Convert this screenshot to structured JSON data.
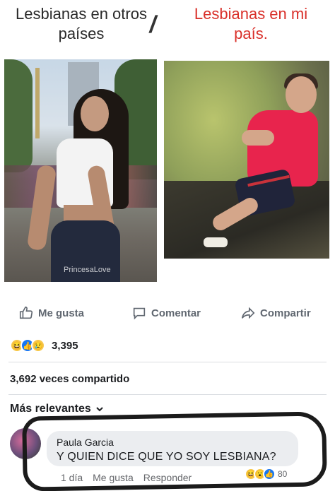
{
  "meme": {
    "left_heading": "Lesbianas en otros países",
    "right_heading": "Lesbianas en mi país.",
    "separator": "/",
    "watermark": "PrincesaLove"
  },
  "post_actions": {
    "like": "Me gusta",
    "comment": "Comentar",
    "share": "Compartir"
  },
  "reactions": {
    "count": "3,395",
    "types": [
      "haha",
      "like",
      "sad"
    ]
  },
  "shares": "3,692 veces compartido",
  "comments_filter": {
    "label": "Más relevantes",
    "icon": "chevron-down-icon"
  },
  "comment": {
    "author": "Paula Garcia",
    "text": "Y QUIEN DICE QUE YO SOY LESBIANA?",
    "time": "1 día",
    "like": "Me gusta",
    "reply": "Responder",
    "reaction_count": "80",
    "reaction_types": [
      "haha",
      "wow",
      "like"
    ]
  },
  "colors": {
    "heading_left": "#2a2a2a",
    "heading_right": "#d9302a",
    "like_blue": "#1877f2",
    "shirt_pink": "#e8244d"
  }
}
